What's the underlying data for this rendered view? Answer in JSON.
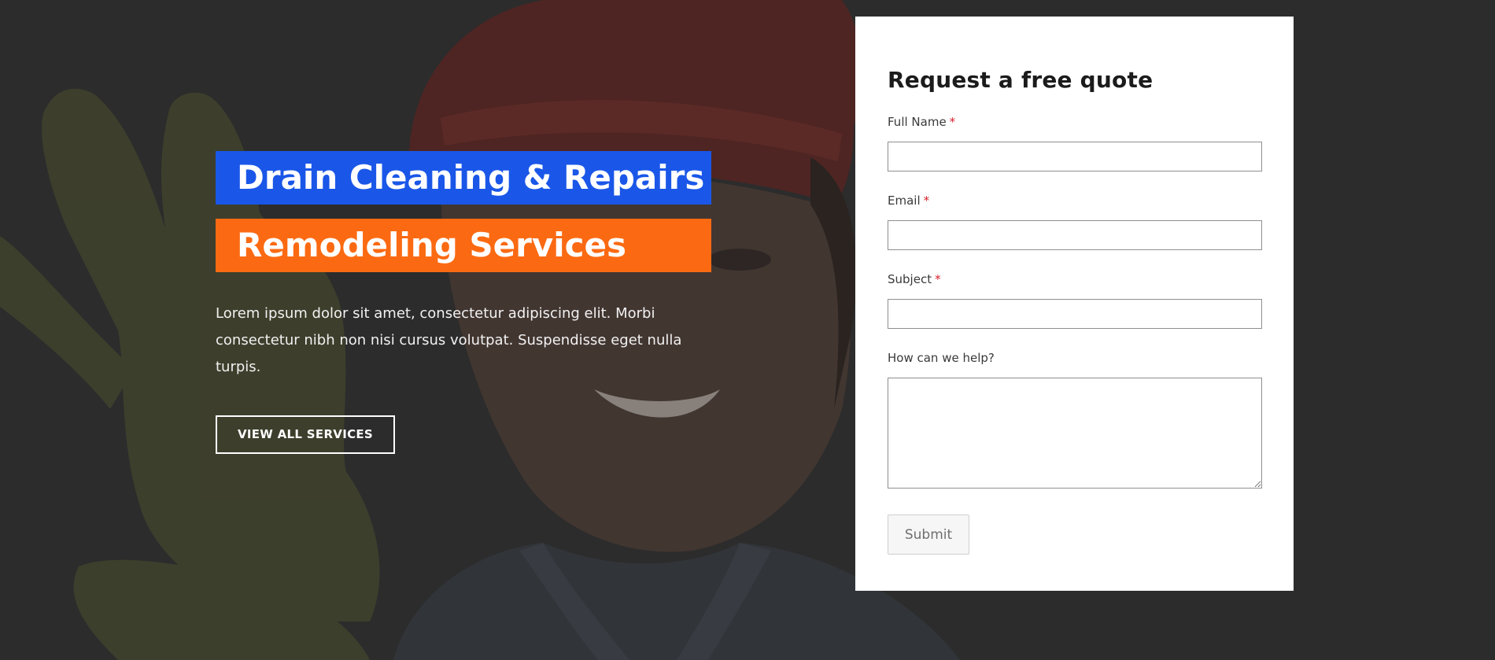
{
  "hero": {
    "headline_line1": "Drain Cleaning & Repairs",
    "headline_line2": "Remodeling Services",
    "body": "Lorem ipsum dolor sit amet, consectetur adipiscing elit. Morbi consectetur nibh non nisi cursus volutpat. Suspendisse eget nulla turpis.",
    "cta_label": "VIEW ALL SERVICES",
    "photo_icon": "worker-photo-icon"
  },
  "quote_form": {
    "title": "Request a free quote",
    "fields": [
      {
        "label": "Full Name",
        "required_mark": "*",
        "value": ""
      },
      {
        "label": "Email",
        "required_mark": "*",
        "value": ""
      },
      {
        "label": "Subject",
        "required_mark": "*",
        "value": ""
      }
    ],
    "message_label": "How can we help?",
    "message_value": "",
    "submit_label": "Submit"
  },
  "colors": {
    "blue": "#1a57e8",
    "orange": "#fb6a12",
    "overlay": "#2d2d2d",
    "required": "#d8202c"
  }
}
